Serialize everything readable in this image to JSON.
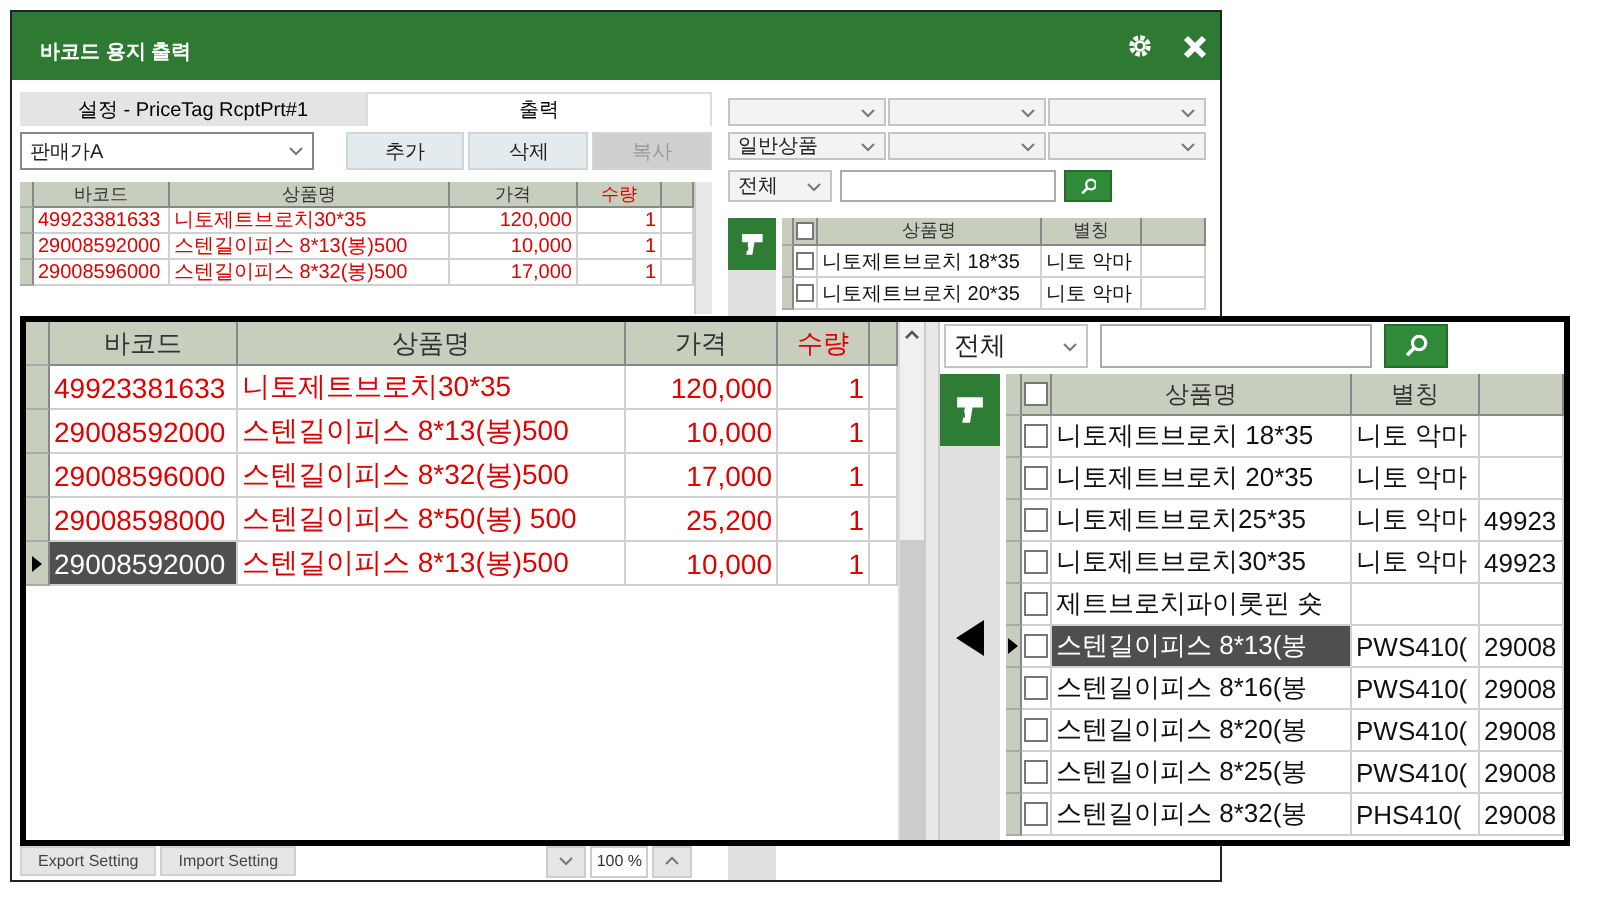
{
  "window": {
    "title": "바코드 용지 출력"
  },
  "settings_panel": {
    "tabs": [
      {
        "label": "설정 - PriceTag RcptPrt#1",
        "selected": false
      },
      {
        "label": "출력",
        "selected": true
      }
    ],
    "price_level": {
      "value": "판매가A"
    },
    "buttons": [
      {
        "label": "추가",
        "disabled": false
      },
      {
        "label": "삭제",
        "disabled": false
      },
      {
        "label": "복사",
        "disabled": true
      }
    ],
    "table": {
      "columns": [
        {
          "label": "바코드",
          "emphasized": false
        },
        {
          "label": "상품명",
          "emphasized": false
        },
        {
          "label": "가격",
          "emphasized": false
        },
        {
          "label": "수량",
          "emphasized": true
        }
      ],
      "rows": [
        {
          "cells": [
            "49923381633",
            "니토제트브로치30*35",
            "120,000",
            "1"
          ],
          "selected": false
        },
        {
          "cells": [
            "29008592000",
            "스텐길이피스 8*13(봉)500",
            "10,000",
            "1"
          ],
          "selected": false
        },
        {
          "cells": [
            "29008596000",
            "스텐길이피스 8*32(봉)500",
            "17,000",
            "1"
          ],
          "selected": false
        }
      ]
    },
    "footer_buttons": [
      "Export Setting",
      "Import Setting"
    ],
    "zoom_level": "100 %"
  },
  "product_panel": {
    "category_filter": {
      "value": "일반상품"
    },
    "search": {
      "scope": "전체"
    },
    "table": {
      "all_checked": false,
      "columns": [
        {
          "label": "상품명"
        },
        {
          "label": "별칭"
        }
      ],
      "rows": [
        {
          "cells": [
            "니토제트브로치 18*35",
            "니토 악마"
          ],
          "checked": false,
          "selected": false
        },
        {
          "cells": [
            "니토제트브로치 20*35",
            "니토 악마"
          ],
          "checked": false,
          "selected": false
        }
      ]
    }
  },
  "zoom_inset": {
    "settings_table": {
      "columns": [
        {
          "label": "바코드",
          "emphasized": false
        },
        {
          "label": "상품명",
          "emphasized": false
        },
        {
          "label": "가격",
          "emphasized": false
        },
        {
          "label": "수량",
          "emphasized": true
        }
      ],
      "rows": [
        {
          "cells": [
            "49923381633",
            "니토제트브로치30*35",
            "120,000",
            "1"
          ],
          "selected": false
        },
        {
          "cells": [
            "29008592000",
            "스텐길이피스 8*13(봉)500",
            "10,000",
            "1"
          ],
          "selected": false
        },
        {
          "cells": [
            "29008596000",
            "스텐길이피스 8*32(봉)500",
            "17,000",
            "1"
          ],
          "selected": false
        },
        {
          "cells": [
            "29008598000",
            "스텐길이피스 8*50(봉) 500",
            "25,200",
            "1"
          ],
          "selected": false
        },
        {
          "cells": [
            "29008592000",
            "스텐길이피스 8*13(봉)500",
            "10,000",
            "1"
          ],
          "selected": true
        }
      ]
    },
    "search": {
      "scope": "전체"
    },
    "product_table": {
      "all_checked": false,
      "columns": [
        {
          "label": "상품명"
        },
        {
          "label": "별칭"
        }
      ],
      "rows": [
        {
          "cells": [
            "니토제트브로치 18*35",
            "니토 악마"
          ],
          "checked": false,
          "selected": false
        },
        {
          "cells": [
            "니토제트브로치 20*35",
            "니토 악마"
          ],
          "checked": false,
          "selected": false
        },
        {
          "cells": [
            "니토제트브로치25*35",
            "니토 악마",
            "49923"
          ],
          "checked": false,
          "selected": false
        },
        {
          "cells": [
            "니토제트브로치30*35",
            "니토 악마",
            "49923"
          ],
          "checked": false,
          "selected": false
        },
        {
          "cells": [
            "제트브로치파이롯핀 숏"
          ],
          "checked": false,
          "selected": false
        },
        {
          "cells": [
            "스텐길이피스 8*13(봉",
            "PWS410(",
            "29008"
          ],
          "checked": false,
          "selected": true
        },
        {
          "cells": [
            "스텐길이피스 8*16(봉",
            "PWS410(",
            "29008"
          ],
          "checked": false,
          "selected": false
        },
        {
          "cells": [
            "스텐길이피스 8*20(봉",
            "PWS410(",
            "29008"
          ],
          "checked": false,
          "selected": false
        },
        {
          "cells": [
            "스텐길이피스 8*25(봉",
            "PWS410(",
            "29008"
          ],
          "checked": false,
          "selected": false
        },
        {
          "cells": [
            "스텐길이피스 8*32(봉",
            "PHS410(",
            "29008"
          ],
          "checked": false,
          "selected": false
        }
      ]
    }
  }
}
